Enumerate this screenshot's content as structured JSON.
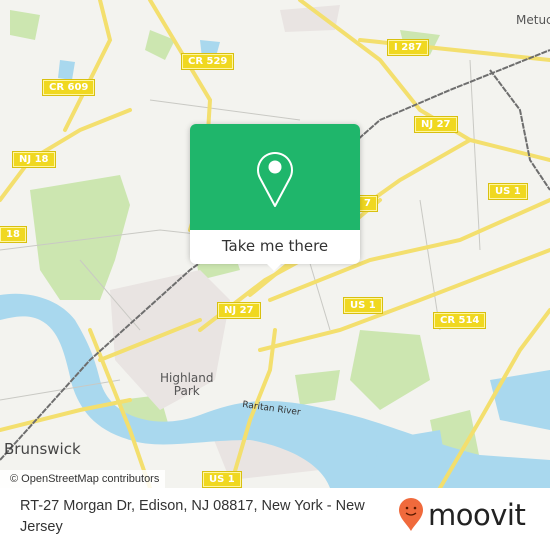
{
  "map": {
    "road_labels": [
      {
        "id": "cr609",
        "text": "CR 609"
      },
      {
        "id": "cr529",
        "text": "CR 529"
      },
      {
        "id": "i287",
        "text": "I 287"
      },
      {
        "id": "nj27a",
        "text": "NJ 27"
      },
      {
        "id": "nj18a",
        "text": "NJ 18"
      },
      {
        "id": "nj18b",
        "text": "18"
      },
      {
        "id": "nj27b",
        "text": "7"
      },
      {
        "id": "us1a",
        "text": "US 1"
      },
      {
        "id": "nj27c",
        "text": "NJ 27"
      },
      {
        "id": "us1b",
        "text": "US 1"
      },
      {
        "id": "cr514",
        "text": "CR 514"
      },
      {
        "id": "us1c",
        "text": "US 1"
      }
    ],
    "place_labels": {
      "metuchen": "Metuc",
      "highland_park": "Highland\nPark",
      "new_brunswick": "Brunswick",
      "raritan_river": "Raritan River"
    },
    "attribution": "© OpenStreetMap contributors",
    "colors": {
      "land": "#f3f3ef",
      "water": "#a9d8ee",
      "park": "#cce6b0",
      "road": "#f3df6e",
      "rail": "#6e6e6e",
      "shield": "#f0d820"
    }
  },
  "popup": {
    "icon": "location-pin-icon",
    "button_label": "Take me there",
    "color": "#1fb66b"
  },
  "footer": {
    "address": "RT-27 Morgan Dr, Edison, NJ 08817, New York - New Jersey",
    "logo_text": "moovit",
    "logo_color": "#f06a3c"
  }
}
